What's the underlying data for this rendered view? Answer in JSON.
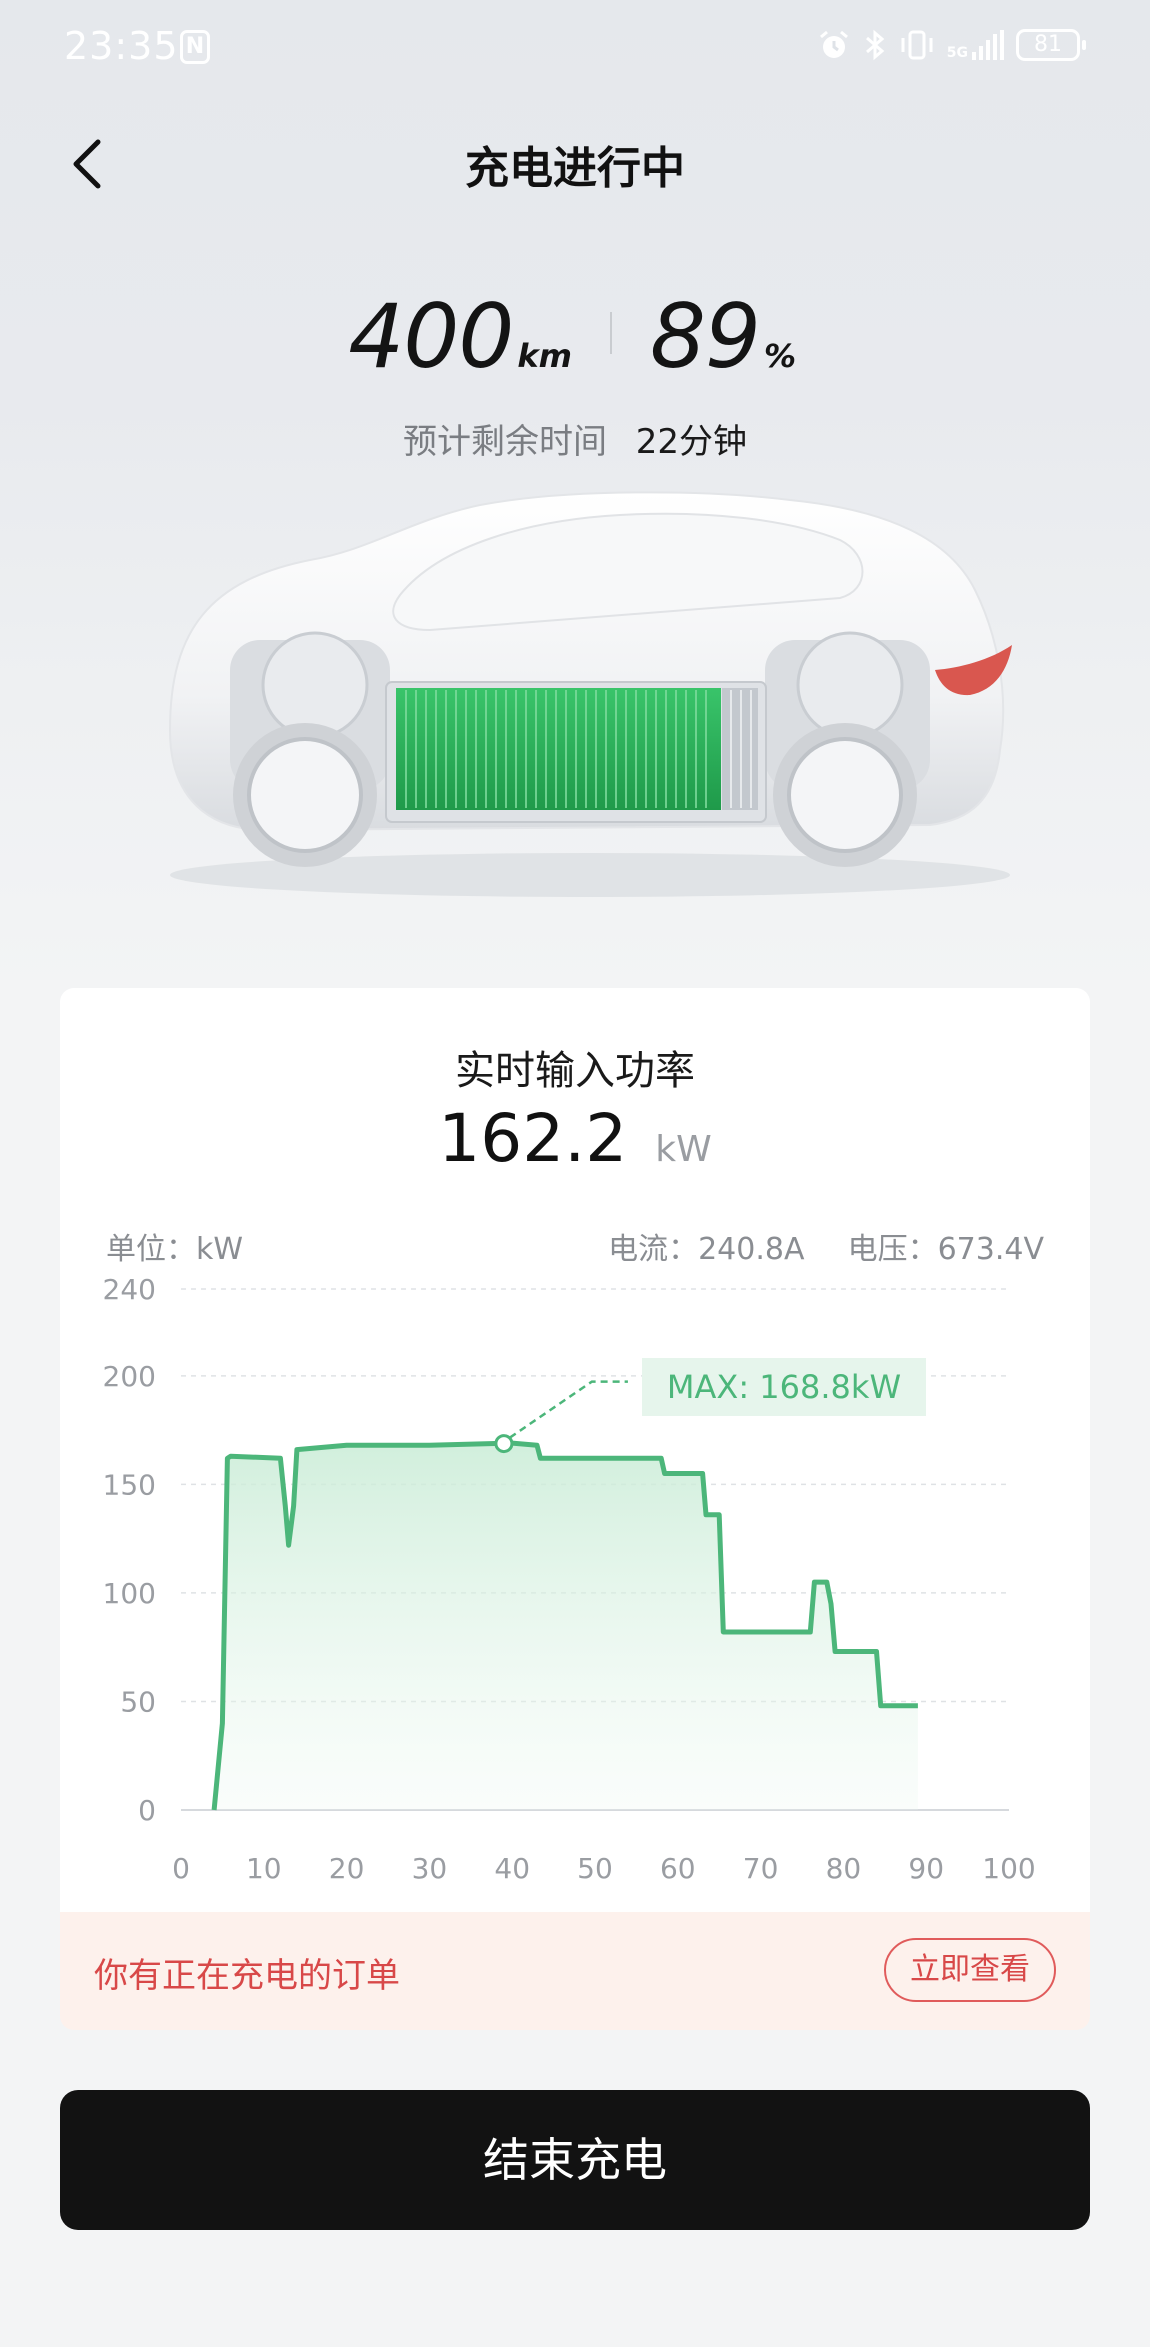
{
  "status_bar": {
    "time": "23:35",
    "nfc_glyph": "N",
    "network": "5G",
    "battery_level": "81",
    "icons": [
      "alarm-icon",
      "bluetooth-icon",
      "vibrate-icon",
      "signal-icon",
      "battery-icon"
    ]
  },
  "header": {
    "title": "充电进行中",
    "back_icon": "chevron-left-icon"
  },
  "stats": {
    "range_value": "400",
    "range_unit": "km",
    "soc_value": "89",
    "soc_unit": "%",
    "remaining_label": "预计剩余时间",
    "remaining_value": "22分钟"
  },
  "power_card": {
    "title": "实时输入功率",
    "power_value": "162.2",
    "power_unit": "kW",
    "unit_label": "单位：kW",
    "current_label": "电流：240.8A",
    "voltage_label": "电压：673.4V",
    "max_label": "MAX: 168.8kW"
  },
  "chart_data": {
    "type": "area",
    "title": "",
    "xlabel": "",
    "ylabel": "",
    "xlim": [
      0,
      100
    ],
    "ylim": [
      0,
      240
    ],
    "x_ticks": [
      0,
      10,
      20,
      30,
      40,
      50,
      60,
      70,
      80,
      90,
      100
    ],
    "y_ticks": [
      0,
      50,
      100,
      150,
      200,
      240
    ],
    "grid": true,
    "line_color": "#4cb67a",
    "max_point": {
      "x": 39,
      "y": 168.8
    },
    "series": [
      {
        "x": [
          4,
          5,
          5.6,
          6,
          12,
          12.6,
          13,
          13.6,
          14,
          20,
          30,
          40,
          43,
          43.4,
          55,
          58,
          58.4,
          63,
          63.4,
          65,
          65.5,
          66,
          75,
          76,
          76.5,
          78,
          78.5,
          79,
          84,
          84.5,
          85,
          89
        ],
        "y": [
          0,
          40,
          162,
          163,
          162,
          140,
          122,
          140,
          166,
          168,
          168,
          169,
          168,
          162,
          162,
          162,
          155,
          155,
          136,
          136,
          82,
          82,
          82,
          82,
          105,
          105,
          95,
          73,
          73,
          48,
          48,
          48
        ]
      }
    ]
  },
  "order_banner": {
    "text": "你有正在充电的订单",
    "button_label": "立即查看"
  },
  "footer": {
    "end_button_label": "结束充电"
  }
}
